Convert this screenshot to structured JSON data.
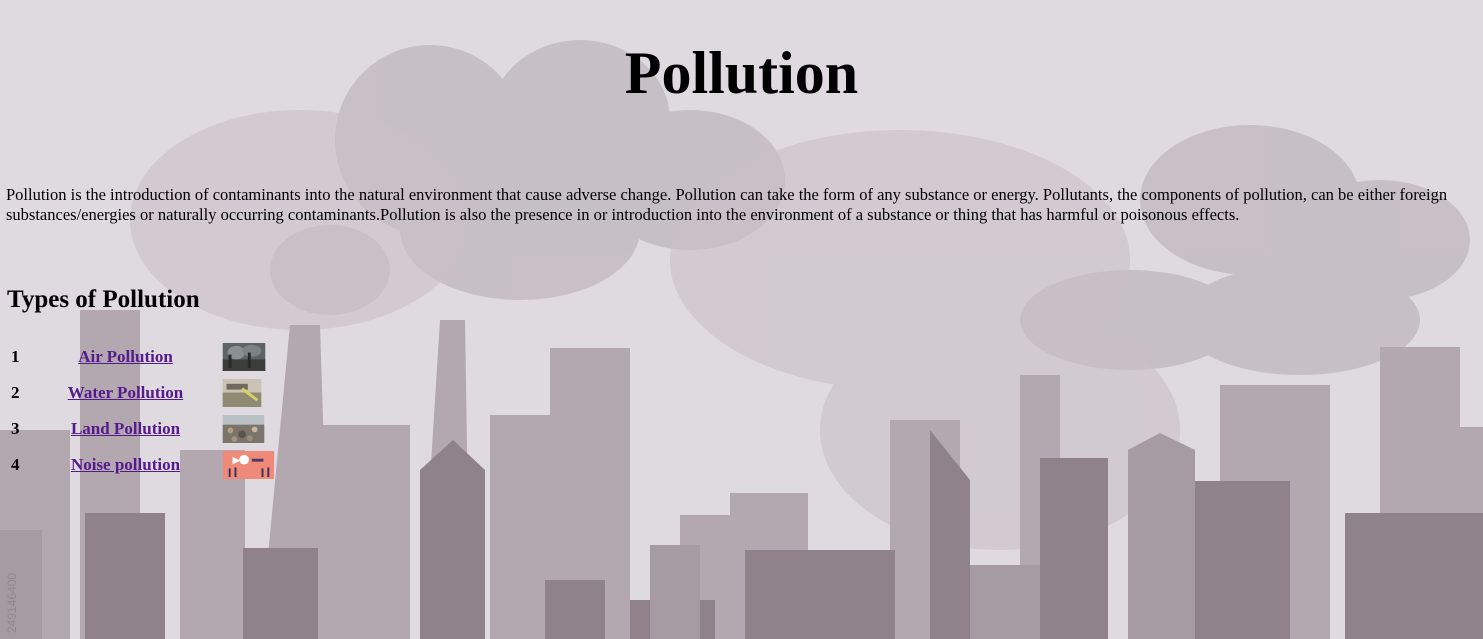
{
  "page": {
    "title": "Pollution",
    "intro": "Pollution is the introduction of contaminants into the natural environment that cause adverse change. Pollution can take the form of any substance or energy. Pollutants, the components of pollution, can be either foreign substances/energies or naturally occurring contaminants.Pollution is also the presence in or introduction into the environment of a substance or thing that has harmful or poisonous effects.",
    "types_heading": "Types of Pollution",
    "background_id": "249146400"
  },
  "types": [
    {
      "number": "1",
      "label": "Air Pollution",
      "thumbnail": "air-pollution-thumbnail"
    },
    {
      "number": "2",
      "label": "Water Pollution",
      "thumbnail": "water-pollution-thumbnail"
    },
    {
      "number": "3",
      "label": "Land Pollution",
      "thumbnail": "land-pollution-thumbnail"
    },
    {
      "number": "4",
      "label": "Noise pollution",
      "thumbnail": "noise-pollution-thumbnail"
    }
  ],
  "colors": {
    "background": "#dedadf",
    "link": "#551a8b"
  }
}
